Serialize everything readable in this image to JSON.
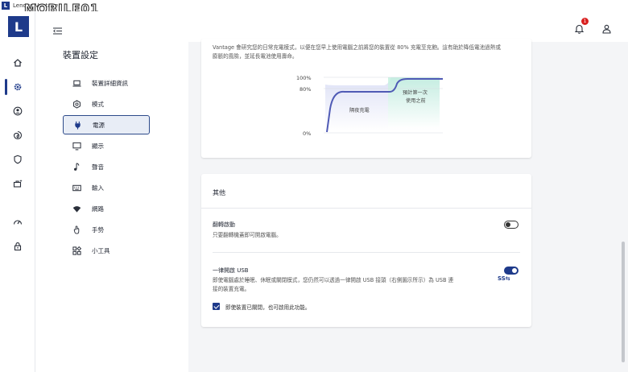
{
  "window": {
    "app_logo": "L",
    "title": "Lenovo Vantage"
  },
  "watermark": "MOBILE01",
  "rail": {
    "logo": "L",
    "items": [
      {
        "icon": "home-icon"
      },
      {
        "icon": "gear-icon",
        "active": true
      },
      {
        "icon": "account-circle-icon"
      },
      {
        "icon": "swirl-icon"
      },
      {
        "icon": "shield-icon"
      },
      {
        "icon": "briefcase-sparkle-icon"
      },
      {
        "icon": "speedometer-icon"
      },
      {
        "icon": "lock-icon"
      }
    ]
  },
  "header": {
    "notification_count": "1"
  },
  "nav": {
    "title": "裝置設定",
    "items": [
      {
        "label": "裝置詳細資訊",
        "icon": "laptop-icon"
      },
      {
        "label": "模式",
        "icon": "hexagon-icon"
      },
      {
        "label": "電源",
        "icon": "plug-icon",
        "active": true
      },
      {
        "label": "顯示",
        "icon": "monitor-icon"
      },
      {
        "label": "聲音",
        "icon": "music-note-icon"
      },
      {
        "label": "輸入",
        "icon": "keyboard-icon"
      },
      {
        "label": "網路",
        "icon": "wifi-icon"
      },
      {
        "label": "手勢",
        "icon": "hand-icon"
      },
      {
        "label": "小工具",
        "icon": "widgets-icon"
      }
    ]
  },
  "charging": {
    "description": "Vantage 會研究您的日常充電模式，以便在您早上使用電腦之前將您的裝置從 80% 充電至充飽。這有助於降低電池過熱或膨脹的風險，並延長電池使用壽命。",
    "chart": {
      "y_labels": [
        "100%",
        "80%",
        "0%"
      ],
      "overnight_label": "隔夜充電",
      "before_use_line1": "預計第一次",
      "before_use_line2": "使用之前"
    }
  },
  "other": {
    "section_title": "其他",
    "flip_to_boot": {
      "title": "翻轉啟動",
      "description": "只要翻轉機蓋即可開啟電腦。",
      "enabled": false
    },
    "always_on_usb": {
      "title": "一律開啟 USB",
      "description_line1": "即使電腦處於睡眠、休眠或關閉模式，您仍然可以透過一律開啟 USB 接頭（右側圖示所示）為 USB 連",
      "description_line2": "接的裝置充電。",
      "enabled": true,
      "usb_icon_text": "SS⇆"
    },
    "checkbox": {
      "label": "即使裝置已關閉，也可啟用此功能。",
      "checked": true
    }
  }
}
